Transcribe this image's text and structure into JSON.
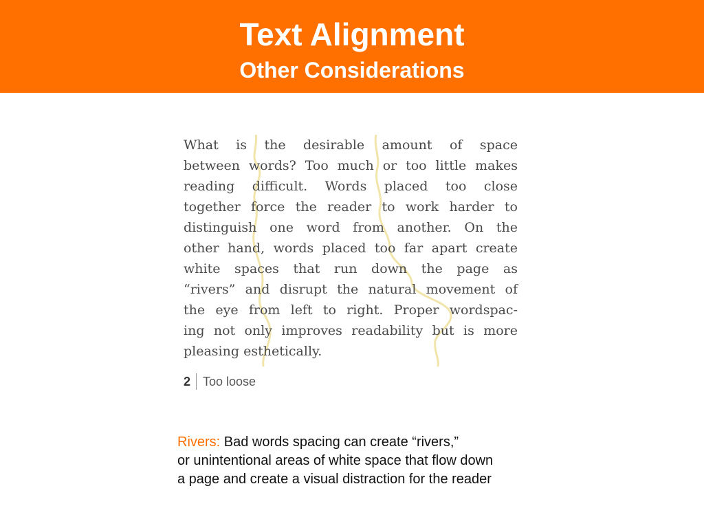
{
  "header": {
    "title": "Text Alignment",
    "subtitle": "Other Considerations"
  },
  "sample": {
    "lines": [
      "What is the desirable amount of space",
      "between words? Too much or too little makes",
      "reading difficult. Words placed too close",
      "together force the reader to work harder to",
      "distinguish one word from another. On the",
      "other hand, words placed too far apart create",
      "white spaces that run down the page as",
      "“rivers” and disrupt the natural movement of",
      "the eye from left to right. Proper wordspac-",
      "ing not only improves readability but is more",
      "pleasing esthetically."
    ],
    "figure_number": "2",
    "figure_caption": "Too loose"
  },
  "note": {
    "label": "Rivers:",
    "line1": " Bad words spacing can create “rivers,”",
    "line2": "or unintentional areas of white space that flow down",
    "line3": "a page and create a visual distraction for the reader"
  },
  "colors": {
    "accent": "#ff7000",
    "river_highlight": "#efe2a2"
  }
}
